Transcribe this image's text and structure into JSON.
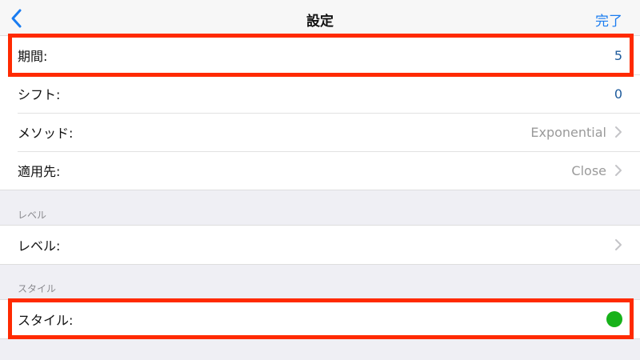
{
  "navbar": {
    "title": "設定",
    "done_label": "完了",
    "back_icon": "chevron-left-icon"
  },
  "indicator_settings": [
    {
      "label": "期間:",
      "value": "5"
    },
    {
      "label": "シフト:",
      "value": "0"
    },
    {
      "label": "メソッド:",
      "value": "Exponential"
    },
    {
      "label": "適用先:",
      "value": "Close"
    }
  ],
  "levels_section": {
    "header": "レベル",
    "row_label": "レベル:"
  },
  "style_section": {
    "header": "スタイル",
    "row_label": "スタイル:",
    "color": "#17b21a"
  },
  "colors": {
    "accent": "#1a7cf0",
    "value_text": "#1e5b9c",
    "highlight": "#ff2a00"
  }
}
